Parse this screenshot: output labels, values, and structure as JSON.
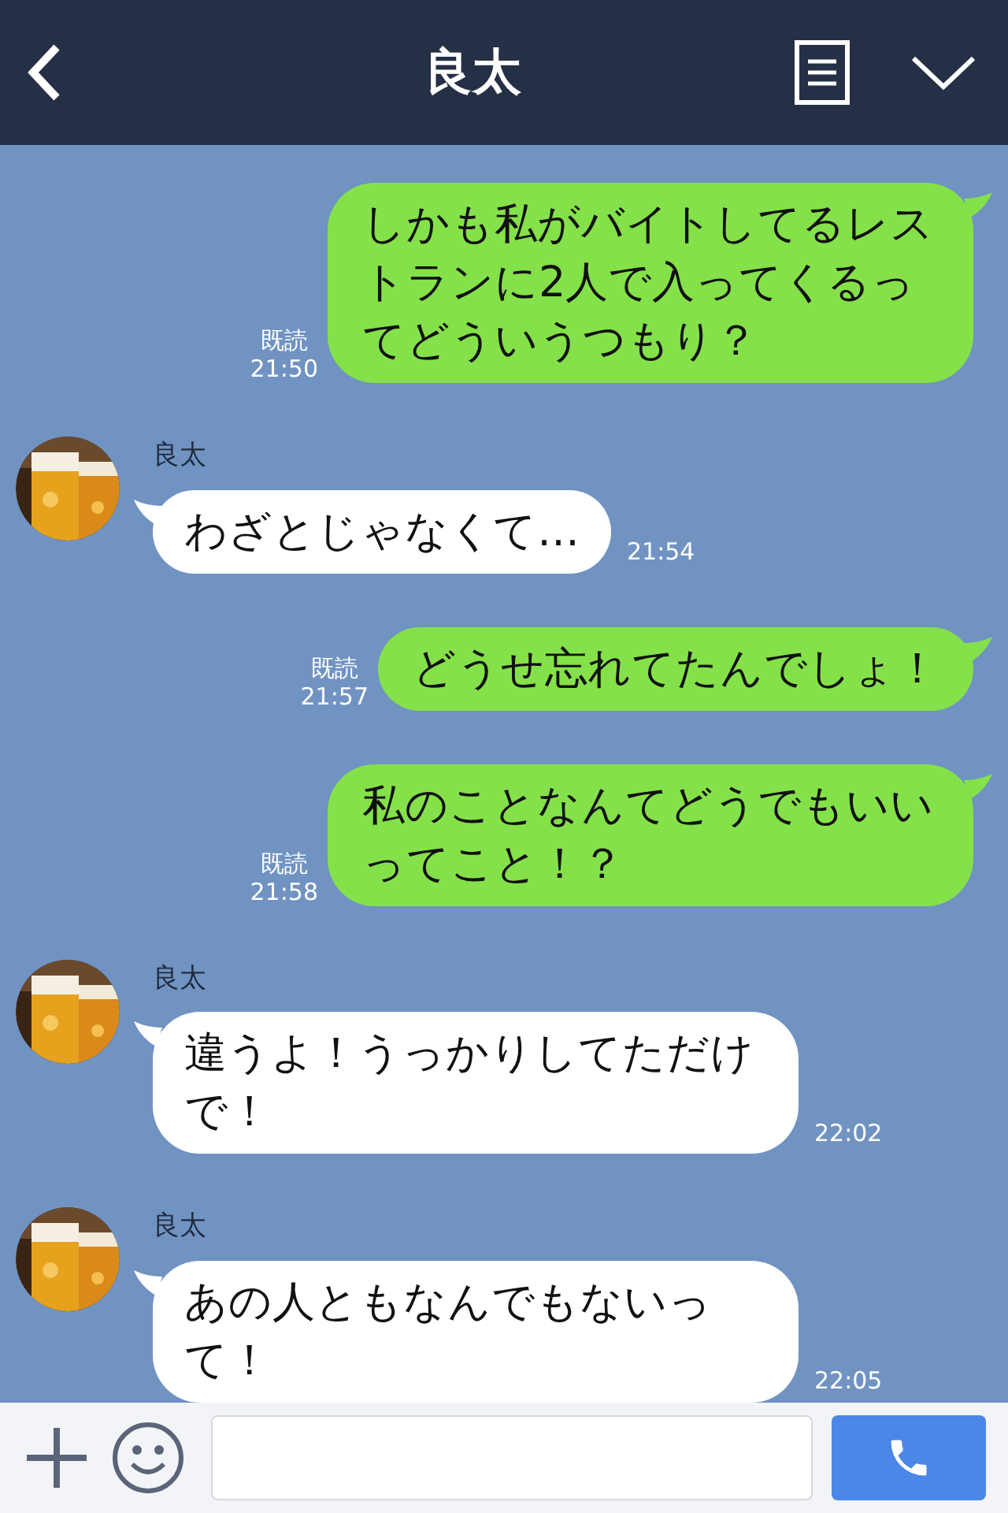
{
  "header": {
    "title": "良太"
  },
  "messages": [
    {
      "kind": "sent",
      "text": "しかも私がバイトしてるレストランに2人で入ってくるってどういうつもり？",
      "read": "既読",
      "time": "21:50"
    },
    {
      "kind": "received",
      "name": "良太",
      "text": "わざとじゃなくて…",
      "time": "21:54"
    },
    {
      "kind": "sent",
      "text": "どうせ忘れてたんでしょ！",
      "read": "既読",
      "time": "21:57"
    },
    {
      "kind": "sent",
      "text": "私のことなんてどうでもいいってこと！？",
      "read": "既読",
      "time": "21:58"
    },
    {
      "kind": "received",
      "name": "良太",
      "text": "違うよ！うっかりしてただけで！",
      "time": "22:02"
    },
    {
      "kind": "received",
      "name": "良太",
      "text": "あの人ともなんでもないって！",
      "time": "22:05"
    }
  ]
}
